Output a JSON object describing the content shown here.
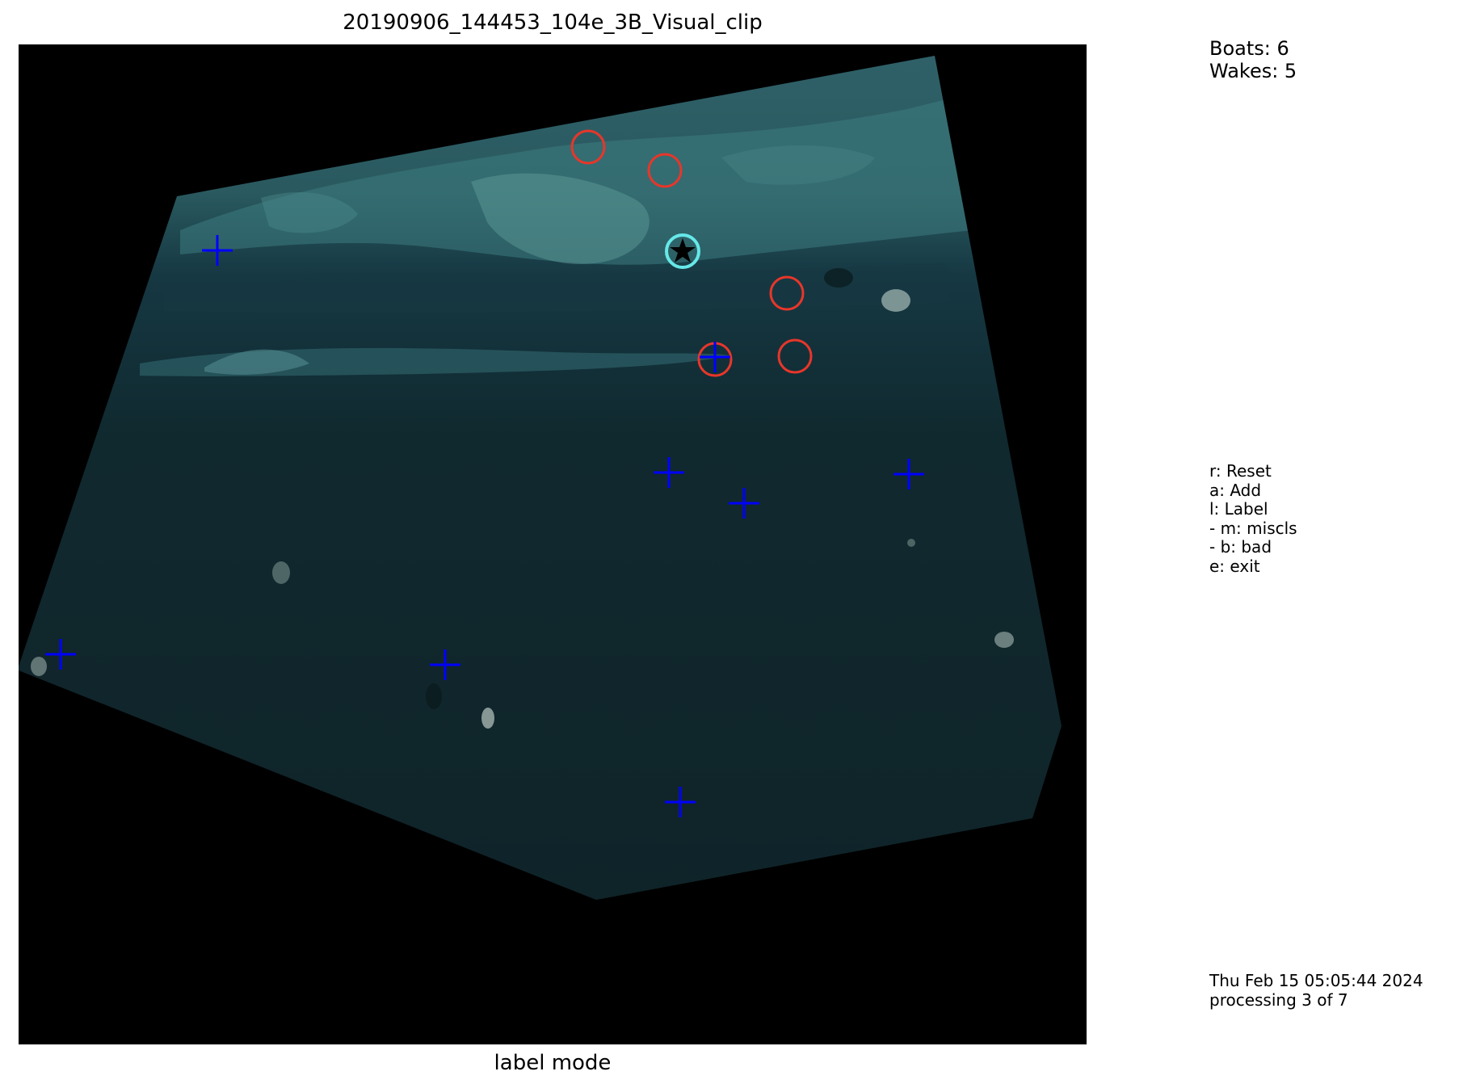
{
  "figure": {
    "title": "20190906_144453_104e_3B_Visual_clip",
    "mode_label": "label mode"
  },
  "counts": {
    "boats": "Boats: 6",
    "wakes": "Wakes: 5"
  },
  "key_help": [
    "r: Reset",
    "a: Add",
    "l: Label",
    "- m: miscls",
    "- b: bad",
    "e: exit"
  ],
  "status": {
    "timestamp": "Thu Feb 15 05:05:44 2024",
    "progress": "processing 3 of 7"
  },
  "colors": {
    "candidate_marker": "#0000ff",
    "wake_circle": "#e8362a",
    "selected_circle": "#66e8e8",
    "selected_star": "#000000",
    "scene_background": "#000000",
    "water": "#0f2830",
    "shallows": "#2d5e64"
  },
  "marker_icons": {
    "candidate": "plus-marker-icon",
    "wake": "circle-marker-icon",
    "selected": "star-marker-icon"
  }
}
